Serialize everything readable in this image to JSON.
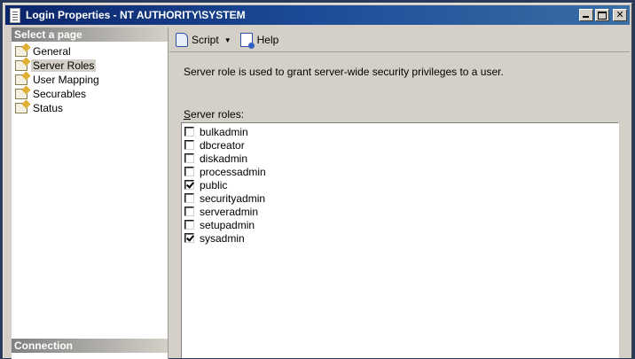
{
  "window": {
    "title": "Login Properties - NT AUTHORITY\\SYSTEM"
  },
  "left_pane": {
    "header": "Select a page",
    "items": [
      {
        "label": "General",
        "selected": false
      },
      {
        "label": "Server Roles",
        "selected": true
      },
      {
        "label": "User Mapping",
        "selected": false
      },
      {
        "label": "Securables",
        "selected": false
      },
      {
        "label": "Status",
        "selected": false
      }
    ],
    "connection_header": "Connection"
  },
  "toolbar": {
    "script_label": "Script",
    "help_label": "Help"
  },
  "content": {
    "description": "Server role is used to grant server-wide security privileges to a user.",
    "roles_label_accel": "S",
    "roles_label_rest": "erver roles:",
    "roles": [
      {
        "name": "bulkadmin",
        "checked": false
      },
      {
        "name": "dbcreator",
        "checked": false
      },
      {
        "name": "diskadmin",
        "checked": false
      },
      {
        "name": "processadmin",
        "checked": false
      },
      {
        "name": "public",
        "checked": true
      },
      {
        "name": "securityadmin",
        "checked": false
      },
      {
        "name": "serveradmin",
        "checked": false
      },
      {
        "name": "setupadmin",
        "checked": false
      },
      {
        "name": "sysadmin",
        "checked": true
      }
    ]
  }
}
